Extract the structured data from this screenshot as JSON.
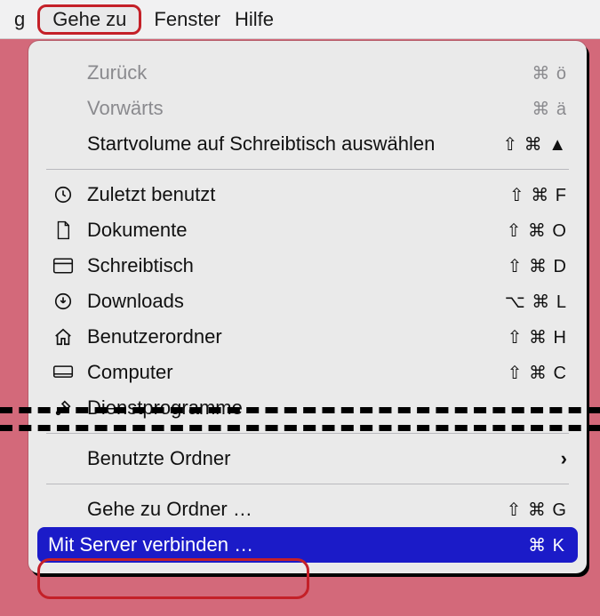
{
  "menubar": {
    "left_fragment": "g",
    "selected": "Gehe zu",
    "item2": "Fenster",
    "item3": "Hilfe"
  },
  "menu": {
    "back": {
      "label": "Zurück",
      "shortcut": "⌘ ö"
    },
    "forward": {
      "label": "Vorwärts",
      "shortcut": "⌘ ä"
    },
    "startvolume": {
      "label": "Startvolume auf Schreibtisch auswählen",
      "shortcut": "⇧ ⌘ ▲"
    },
    "recents": {
      "label": "Zuletzt benutzt",
      "shortcut": "⇧ ⌘ F"
    },
    "documents": {
      "label": "Dokumente",
      "shortcut": "⇧ ⌘ O"
    },
    "desktop": {
      "label": "Schreibtisch",
      "shortcut": "⇧ ⌘ D"
    },
    "downloads": {
      "label": "Downloads",
      "shortcut": "⌥ ⌘ L"
    },
    "home": {
      "label": "Benutzerordner",
      "shortcut": "⇧ ⌘ H"
    },
    "computer": {
      "label": "Computer",
      "shortcut": "⇧ ⌘ C"
    },
    "utilities": {
      "label": "Dienstprogramme",
      "shortcut": ""
    },
    "recent_folders": {
      "label": "Benutzte Ordner"
    },
    "goto_folder": {
      "label": "Gehe zu Ordner …",
      "shortcut": "⇧ ⌘ G"
    },
    "connect_server": {
      "label": "Mit Server verbinden …",
      "shortcut": "⌘ K"
    }
  }
}
